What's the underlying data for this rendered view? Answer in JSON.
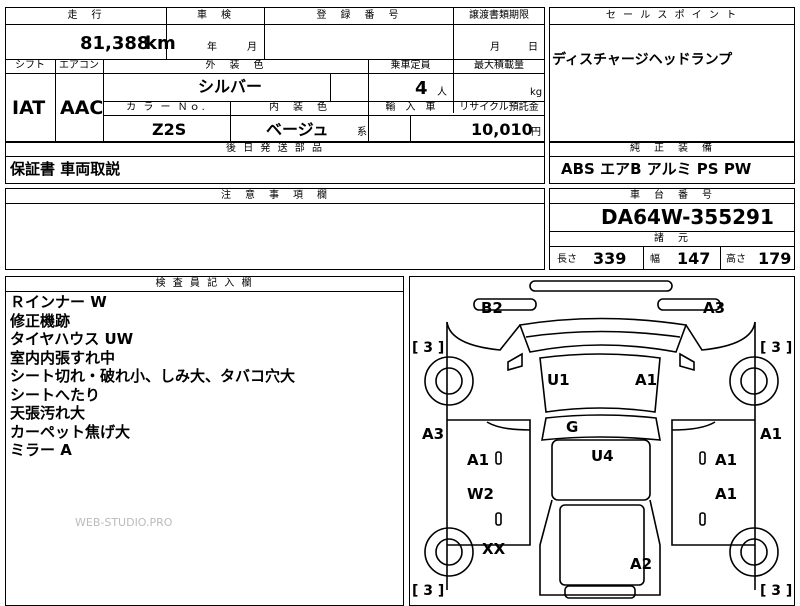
{
  "header": {
    "mileage_label": "走　行",
    "inspection_label": "車　検",
    "registration_label": "登　録　番　号",
    "transfer_deadline_label": "譲渡書類期限",
    "sales_point_label": "セ ー ル ス ポ イ ン ト",
    "mileage_value": "81,388",
    "mileage_unit": "km",
    "year_unit": "年",
    "month_unit": "月",
    "deadline_month_unit": "月",
    "deadline_day_unit": "日"
  },
  "row2": {
    "shift_label": "シフト",
    "ac_label": "エアコン",
    "exterior_color_label": "外　装　色",
    "capacity_label": "乗車定員",
    "max_load_label": "最大積載量",
    "shift_value": "IAT",
    "ac_value": "AAC",
    "exterior_color_value": "シルバー",
    "capacity_value": "4",
    "capacity_unit": "人",
    "load_unit": "kg",
    "color_no_label": "カ ラ ー Ｎｏ.",
    "interior_color_label": "内　装　色",
    "import_label": "輸　入　車",
    "recycle_label": "リサイクル預託金",
    "color_no_value": "Z2S",
    "interior_color_value": "ベージュ",
    "interior_suffix": "系",
    "recycle_value": "10,010",
    "recycle_unit": "円"
  },
  "sales_point": {
    "text": "ディスチャージヘッドランプ"
  },
  "later_parts": {
    "label": "後 日 発 送 部 品",
    "value": "保証書 車両取説"
  },
  "equipment": {
    "label": "純　正　装　備",
    "value": "ABS エアB アルミ PS PW"
  },
  "notes": {
    "label": "注　意　事　項　欄"
  },
  "chassis": {
    "label": "車　台　番　号",
    "value": "DA64W-355291"
  },
  "specs": {
    "label": "諸　元",
    "length_label": "長さ",
    "length_value": "339",
    "width_label": "幅",
    "width_value": "147",
    "height_label": "高さ",
    "height_value": "179"
  },
  "inspector": {
    "label": "検 査 員 記 入 欄",
    "lines": [
      "Ｒインナー W",
      "修正機跡",
      "タイヤハウス UW",
      "室内内張すれ中",
      "シート切れ・破れ小、しみ大、タバコ穴大",
      "シートへたり",
      "天張汚れ大",
      "カーペット焦げ大",
      "ミラー A"
    ]
  },
  "watermark": "WEB-STUDIO.PRO",
  "diagram": {
    "bracket_tl": "[ 3 ]",
    "bracket_tr": "[ 3 ]",
    "bracket_bl": "[ 3 ]",
    "bracket_br": "[ 3 ]",
    "codes": {
      "b2": "B2",
      "a3_top": "A3",
      "u1": "U1",
      "a1_roof": "A1",
      "a3_left": "A3",
      "a1_right": "A1",
      "g": "G",
      "u4": "U4",
      "a1_left_front_door": "A1",
      "a1_right_front_door": "A1",
      "w2": "W2",
      "a1_right_rear_door": "A1",
      "xx": "XX",
      "a2": "A2"
    }
  }
}
